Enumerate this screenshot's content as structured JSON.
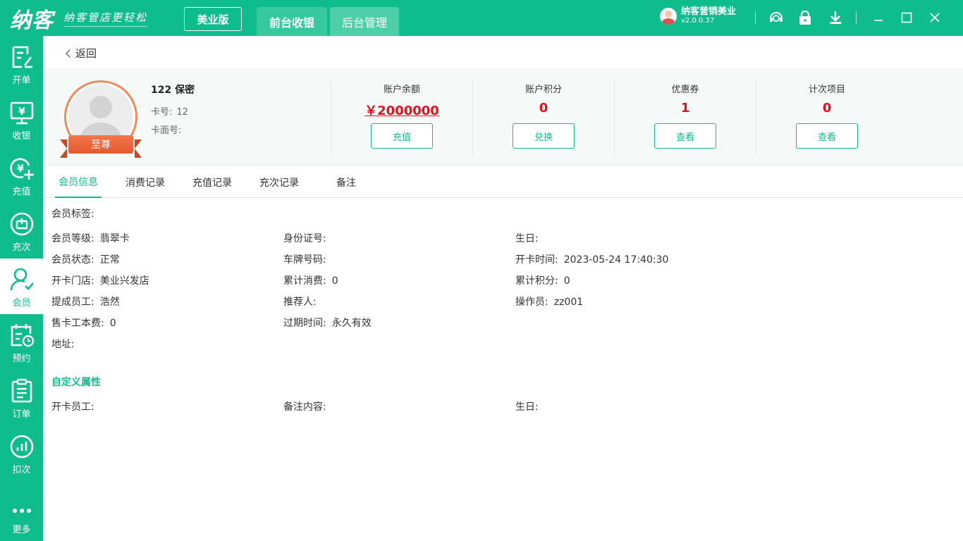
{
  "app": {
    "logo": "纳客",
    "slogan": "纳客管店更轻松",
    "edition": "美业版",
    "tabs": [
      {
        "label": "前台收银"
      },
      {
        "label": "后台管理"
      }
    ],
    "user": {
      "name": "纳客营销美业",
      "version": "v2.0.0.37"
    },
    "top_icons": [
      "headset-icon",
      "lock-icon",
      "download-icon",
      "minimize-icon",
      "maximize-icon",
      "close-icon"
    ]
  },
  "sidebar": {
    "items": [
      {
        "label": "开单",
        "icon": "order-edit-icon"
      },
      {
        "label": "收银",
        "icon": "cashier-icon"
      },
      {
        "label": "充值",
        "icon": "recharge-icon"
      },
      {
        "label": "充次",
        "icon": "recharge-times-icon"
      },
      {
        "label": "会员",
        "icon": "member-icon"
      },
      {
        "label": "预约",
        "icon": "appointment-icon"
      },
      {
        "label": "订单",
        "icon": "order-list-icon"
      },
      {
        "label": "扣次",
        "icon": "deduct-icon"
      },
      {
        "label": "更多",
        "icon": "more-icon"
      }
    ]
  },
  "back": {
    "label": "返回"
  },
  "member": {
    "name": "122 保密",
    "level_badge": "至尊",
    "card_no_label": "卡号:",
    "card_no": "12",
    "card_face_label": "卡面号:",
    "card_face": ""
  },
  "stats": [
    {
      "label": "账户余额",
      "value": "￥2000000",
      "button": "充值"
    },
    {
      "label": "账户积分",
      "value": "0",
      "button": "兑换"
    },
    {
      "label": "优惠券",
      "value": "1",
      "button": "查看"
    },
    {
      "label": "计次项目",
      "value": "0",
      "button": "查看"
    }
  ],
  "tabs": [
    {
      "label": "会员信息"
    },
    {
      "label": "消费记录"
    },
    {
      "label": "充值记录"
    },
    {
      "label": "充次记录"
    },
    {
      "label": "备注"
    }
  ],
  "info": {
    "tags_label": "会员标签:",
    "tags_value": "",
    "fields": [
      {
        "label": "会员等级:",
        "value": "翡翠卡"
      },
      {
        "label": "身份证号:",
        "value": ""
      },
      {
        "label": "生日:",
        "value": ""
      },
      {
        "label": "会员状态:",
        "value": "正常"
      },
      {
        "label": "车牌号码:",
        "value": ""
      },
      {
        "label": "开卡时间:",
        "value": "2023-05-24 17:40:30"
      },
      {
        "label": "开卡门店:",
        "value": "美业兴发店"
      },
      {
        "label": "累计消费:",
        "value": "0"
      },
      {
        "label": "累计积分:",
        "value": "0"
      },
      {
        "label": "提成员工:",
        "value": "浩然"
      },
      {
        "label": "推荐人:",
        "value": ""
      },
      {
        "label": "操作员:",
        "value": "zz001"
      },
      {
        "label": "售卡工本费:",
        "value": "0"
      },
      {
        "label": "过期时间:",
        "value": "永久有效"
      }
    ],
    "address_label": "地址:",
    "address_value": ""
  },
  "custom": {
    "title": "自定义属性",
    "fields": [
      {
        "label": "开卡员工:",
        "value": ""
      },
      {
        "label": "备注内容:",
        "value": ""
      },
      {
        "label": "生日:",
        "value": ""
      }
    ]
  },
  "colors": {
    "brand": "#0fbd8c",
    "danger": "#e8101d",
    "badge": "#f08a5d"
  }
}
